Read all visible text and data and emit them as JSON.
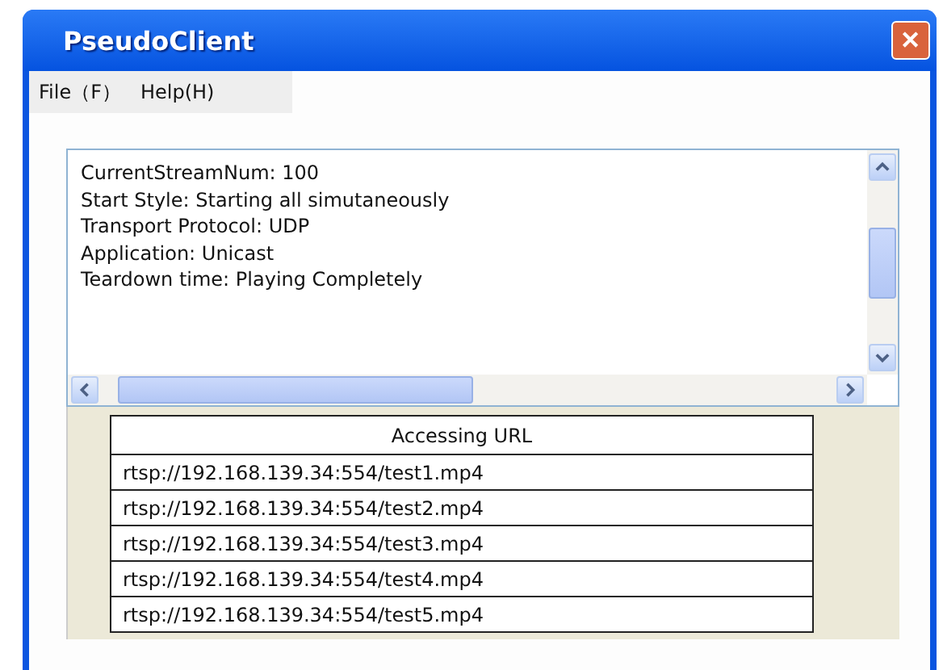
{
  "window": {
    "title": "PseudoClient",
    "close": "✕"
  },
  "menu": [
    {
      "label": "File（F）"
    },
    {
      "label": "Help(H)"
    }
  ],
  "info_lines": [
    "CurrentStreamNum: 100",
    "Start Style: Starting all simutaneously",
    "Transport Protocol: UDP",
    "Application: Unicast",
    "Teardown time: Playing Completely"
  ],
  "table": {
    "columns": [
      "Accessing URL"
    ],
    "rows": [
      "rtsp://192.168.139.34:554/test1.mp4",
      "rtsp://192.168.139.34:554/test2.mp4",
      "rtsp://192.168.139.34:554/test3.mp4",
      "rtsp://192.168.139.34:554/test4.mp4",
      "rtsp://192.168.139.34:554/test5.mp4"
    ]
  }
}
